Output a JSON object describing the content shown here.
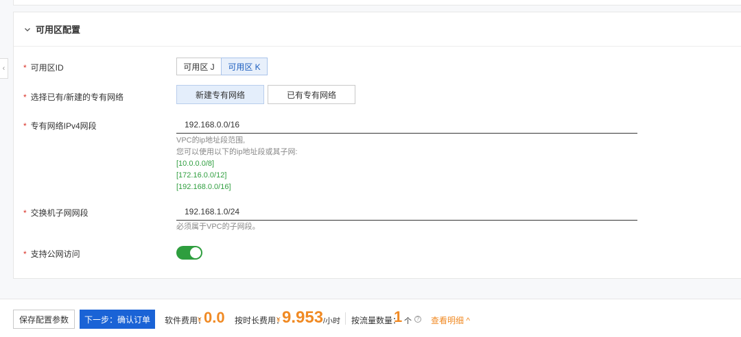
{
  "section": {
    "title": "可用区配置"
  },
  "form": {
    "zone": {
      "label": "可用区ID",
      "options": [
        "可用区 J",
        "可用区 K"
      ],
      "selected": "可用区 K"
    },
    "vpc_choice": {
      "label": "选择已有/新建的专有网络",
      "options": [
        "新建专有网络",
        "已有专有网络"
      ],
      "selected": "新建专有网络"
    },
    "vpc_cidr": {
      "label": "专有网络IPv4网段",
      "value": "192.168.0.0/16",
      "help_line1": "VPC的ip地址段范围,",
      "help_line2": "您可以使用以下的ip地址段或其子网:",
      "suggestions": [
        "[10.0.0.0/8]",
        "[172.16.0.0/12]",
        "[192.168.0.0/16]"
      ]
    },
    "switch_cidr": {
      "label": "交换机子网网段",
      "value": "192.168.1.0/24",
      "help": "必须属于VPC的子网段。"
    },
    "public_access": {
      "label": "支持公网访问",
      "enabled": true
    },
    "required_mark": "*"
  },
  "footer": {
    "save_label": "保存配置参数",
    "next_label": "下一步：确认订单",
    "software_fee_label": "软件费用：",
    "software_fee_value": "0.0",
    "hourly_fee_label": "按时长费用：",
    "hourly_fee_value": "9.953",
    "hourly_fee_unit": "/小时",
    "traffic_label": "按流量数量：",
    "traffic_value": "1",
    "traffic_unit": "个",
    "currency_symbol": "¥",
    "help_glyph": "?",
    "detail_label": "查看明细 ^"
  },
  "colors": {
    "primary": "#1a63d6",
    "price": "#f08a24",
    "toggle_on": "#2e9e3e",
    "required": "#d93026"
  }
}
